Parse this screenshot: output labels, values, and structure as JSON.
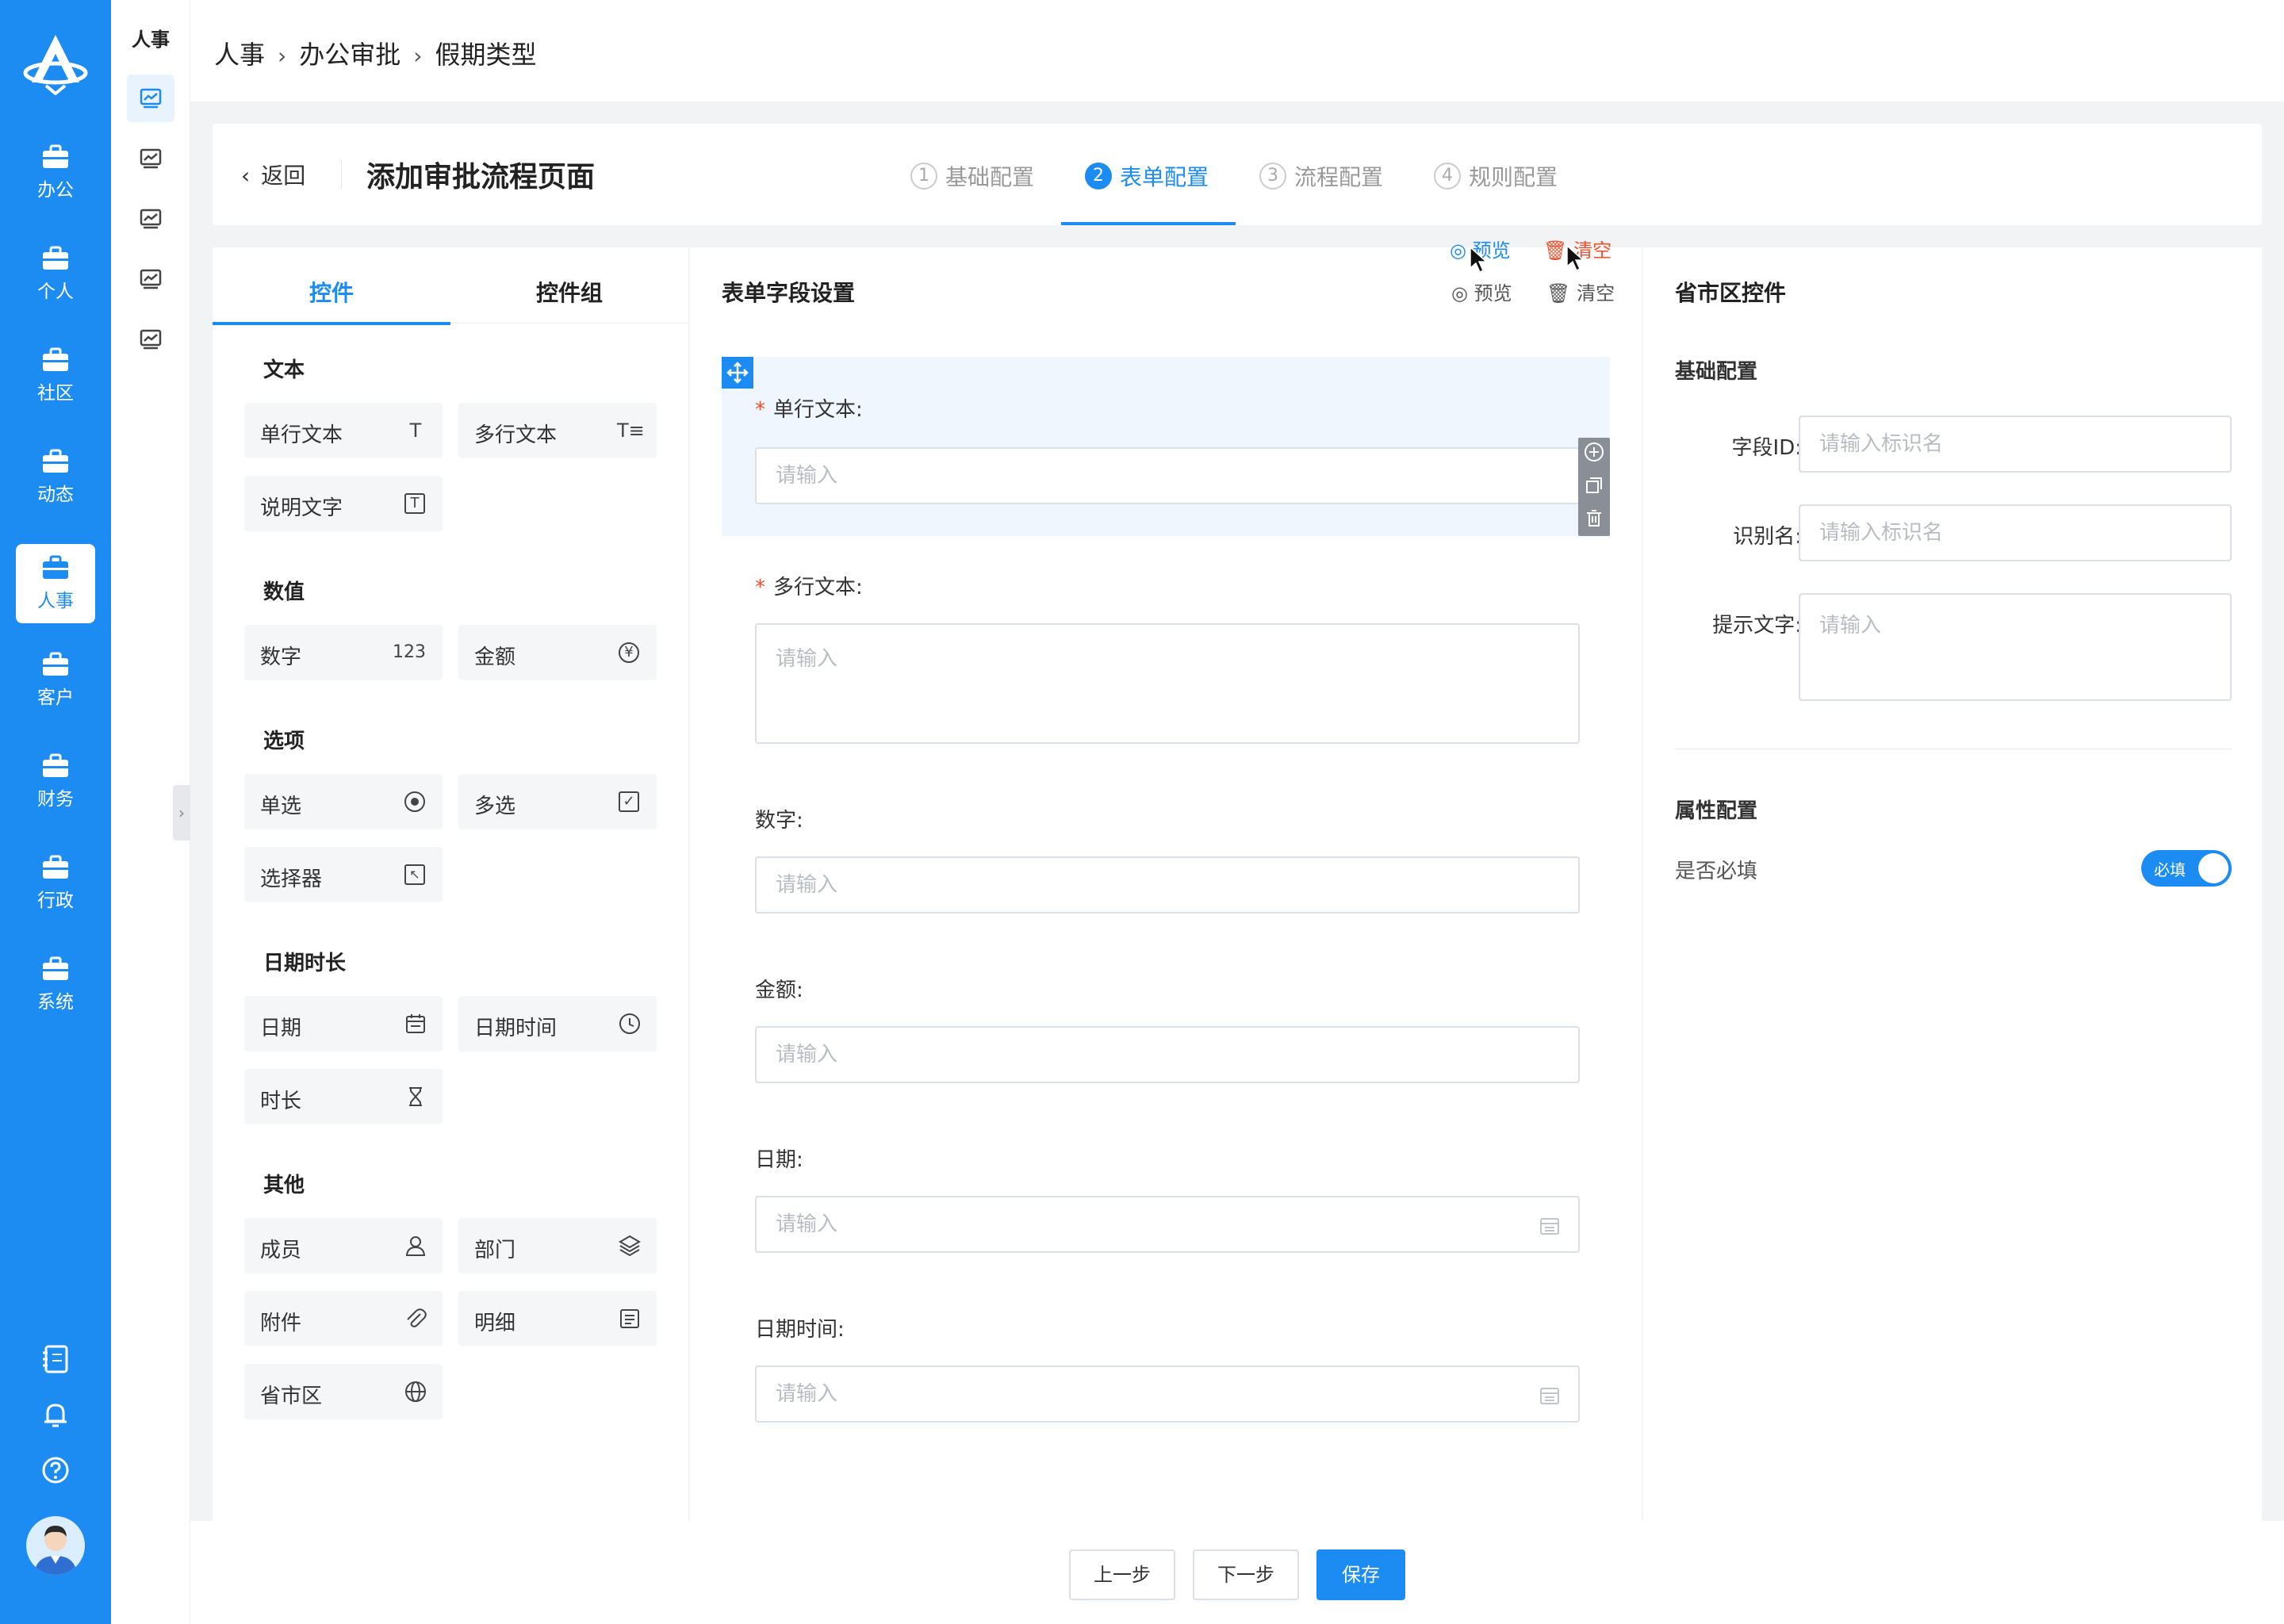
{
  "colors": {
    "primary": "#1d8cf2",
    "danger": "#f0502d",
    "rail": "#1d8cf2"
  },
  "rail": {
    "items": [
      {
        "label": "办公",
        "icon": "briefcase-icon"
      },
      {
        "label": "个人",
        "icon": "briefcase-icon"
      },
      {
        "label": "社区",
        "icon": "briefcase-icon"
      },
      {
        "label": "动态",
        "icon": "briefcase-icon"
      },
      {
        "label": "人事",
        "icon": "briefcase-icon",
        "active": true
      },
      {
        "label": "客户",
        "icon": "briefcase-icon"
      },
      {
        "label": "财务",
        "icon": "briefcase-icon"
      },
      {
        "label": "行政",
        "icon": "briefcase-icon"
      },
      {
        "label": "系统",
        "icon": "briefcase-icon"
      }
    ],
    "bottom_icons": [
      "address-book-icon",
      "bell-icon",
      "help-icon"
    ]
  },
  "subnav": {
    "title": "人事",
    "item_icon": "chart-icon"
  },
  "breadcrumb": [
    "人事",
    "办公审批",
    "假期类型"
  ],
  "header": {
    "back_label": "返回",
    "page_title": "添加审批流程页面",
    "steps": [
      {
        "num": "1",
        "label": "基础配置"
      },
      {
        "num": "2",
        "label": "表单配置",
        "active": true
      },
      {
        "num": "3",
        "label": "流程配置"
      },
      {
        "num": "4",
        "label": "规则配置"
      }
    ]
  },
  "palette": {
    "tabs": [
      "控件",
      "控件组"
    ],
    "groups": [
      {
        "title": "文本",
        "items": [
          {
            "label": "单行文本",
            "icon": "text-icon"
          },
          {
            "label": "多行文本",
            "icon": "multiline-text-icon"
          },
          {
            "label": "说明文字",
            "icon": "text-box-icon"
          }
        ]
      },
      {
        "title": "数值",
        "items": [
          {
            "label": "数字",
            "icon": "number-icon",
            "glyph": "123"
          },
          {
            "label": "金额",
            "icon": "yen-icon"
          }
        ]
      },
      {
        "title": "选项",
        "items": [
          {
            "label": "单选",
            "icon": "radio-icon"
          },
          {
            "label": "多选",
            "icon": "checkbox-icon"
          },
          {
            "label": "选择器",
            "icon": "picker-icon"
          }
        ]
      },
      {
        "title": "日期时长",
        "items": [
          {
            "label": "日期",
            "icon": "calendar-icon"
          },
          {
            "label": "日期时间",
            "icon": "clock-icon"
          },
          {
            "label": "时长",
            "icon": "hourglass-icon"
          }
        ]
      },
      {
        "title": "其他",
        "items": [
          {
            "label": "成员",
            "icon": "user-icon"
          },
          {
            "label": "部门",
            "icon": "layers-icon"
          },
          {
            "label": "附件",
            "icon": "paperclip-icon"
          },
          {
            "label": "明细",
            "icon": "detail-icon"
          },
          {
            "label": "省市区",
            "icon": "globe-icon"
          }
        ]
      }
    ]
  },
  "form": {
    "title": "表单字段设置",
    "preview_label": "预览",
    "clear_label": "清空",
    "fields": [
      {
        "label": "单行文本:",
        "required": "*",
        "placeholder": "请输入"
      },
      {
        "label": "多行文本:",
        "required": "*",
        "placeholder": "请输入"
      },
      {
        "label": "数字:",
        "placeholder": "请输入"
      },
      {
        "label": "金额:",
        "placeholder": "请输入"
      },
      {
        "label": "日期:",
        "placeholder": "请输入"
      },
      {
        "label": "日期时间:",
        "placeholder": "请输入"
      }
    ]
  },
  "config": {
    "title": "省市区控件",
    "basic_title": "基础配置",
    "field_id_label": "字段ID:",
    "field_id_placeholder": "请输入标识名",
    "name_label": "识别名:",
    "name_placeholder": "请输入标识名",
    "hint_label": "提示文字:",
    "hint_placeholder": "请输入",
    "attr_title": "属性配置",
    "required_label": "是否必填",
    "toggle_text": "必填",
    "required_on": true
  },
  "footer": {
    "prev": "上一步",
    "next": "下一步",
    "save": "保存"
  }
}
